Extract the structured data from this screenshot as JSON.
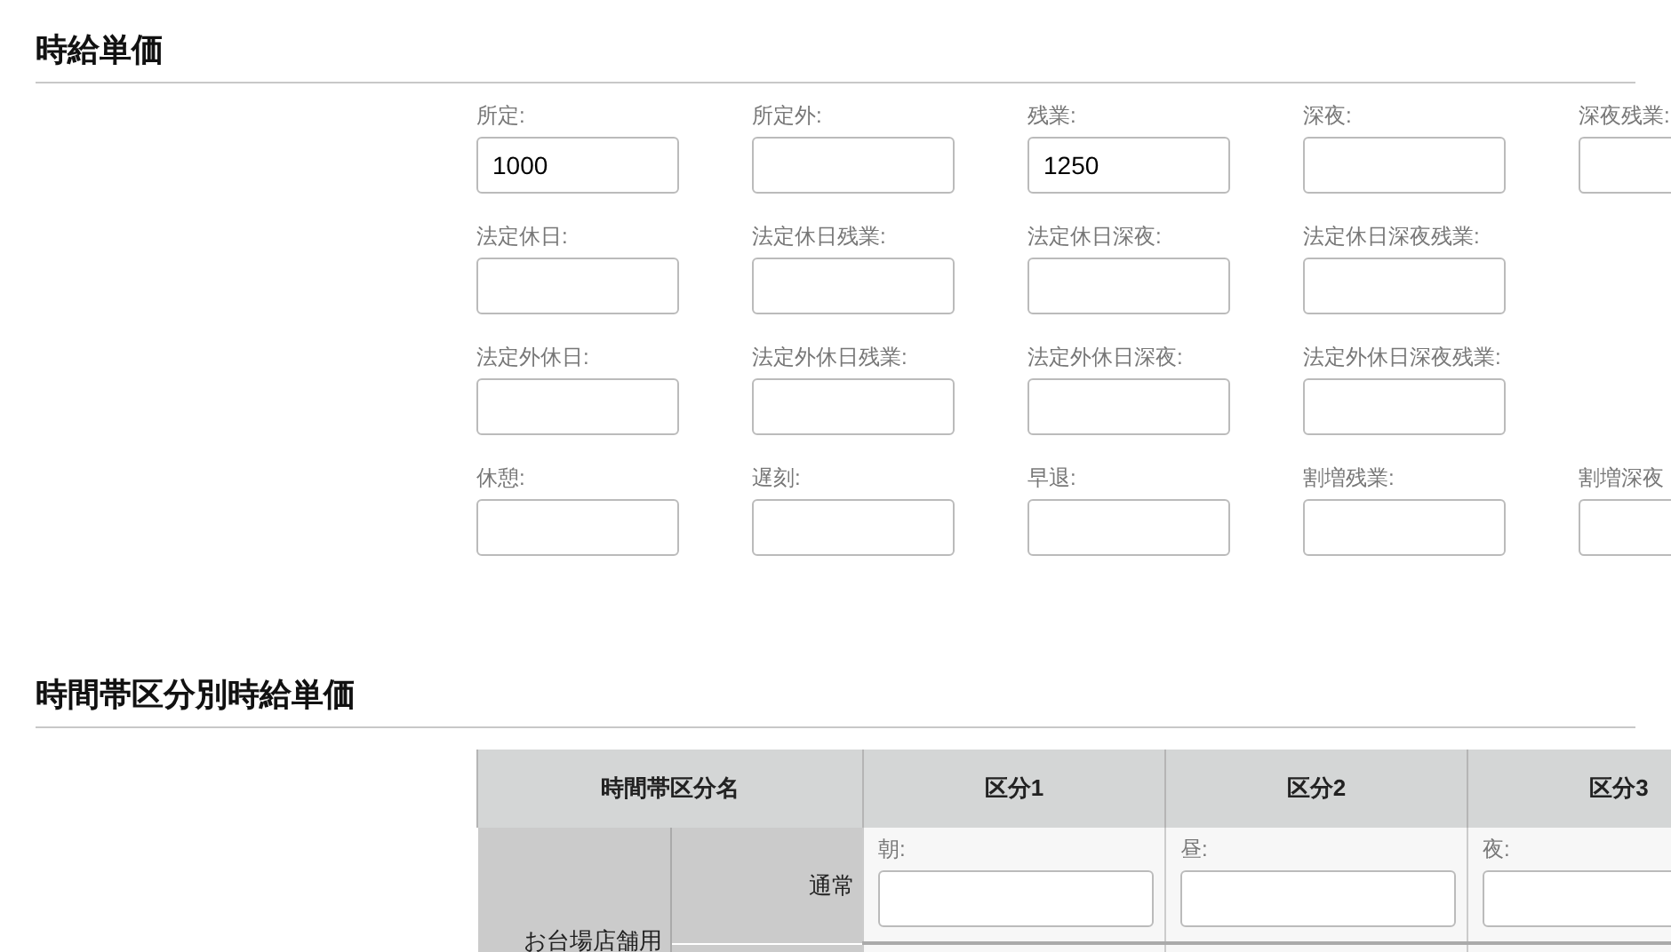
{
  "hourly_rates": {
    "title": "時給単価",
    "rows": [
      [
        {
          "label": "所定:",
          "value": "1000"
        },
        {
          "label": "所定外:"
        },
        {
          "label": "残業:",
          "value": "1250"
        },
        {
          "label": "深夜:"
        },
        {
          "label": "深夜残業:"
        }
      ],
      [
        {
          "label": "法定休日:"
        },
        {
          "label": "法定休日残業:"
        },
        {
          "label": "法定休日深夜:"
        },
        {
          "label": "法定休日深夜残業:"
        }
      ],
      [
        {
          "label": "法定外休日:"
        },
        {
          "label": "法定外休日残業:"
        },
        {
          "label": "法定外休日深夜:"
        },
        {
          "label": "法定外休日深夜残業:"
        }
      ],
      [
        {
          "label": "休憩:"
        },
        {
          "label": "遅刻:"
        },
        {
          "label": "早退:"
        },
        {
          "label": "割増残業:"
        },
        {
          "label": "割増深夜"
        }
      ]
    ]
  },
  "time_band_rates": {
    "title": "時間帯区分別時給単価",
    "table": {
      "columns": [
        {
          "text": "時間帯区分名",
          "colspan": 2
        },
        "区分1",
        "区分2",
        "区分3"
      ],
      "rows": [
        [
          "お台場店舗用",
          "通常",
          {
            "label": "朝:"
          },
          {
            "label": "昼:"
          },
          {
            "label": "夜:"
          }
        ]
      ]
    }
  }
}
